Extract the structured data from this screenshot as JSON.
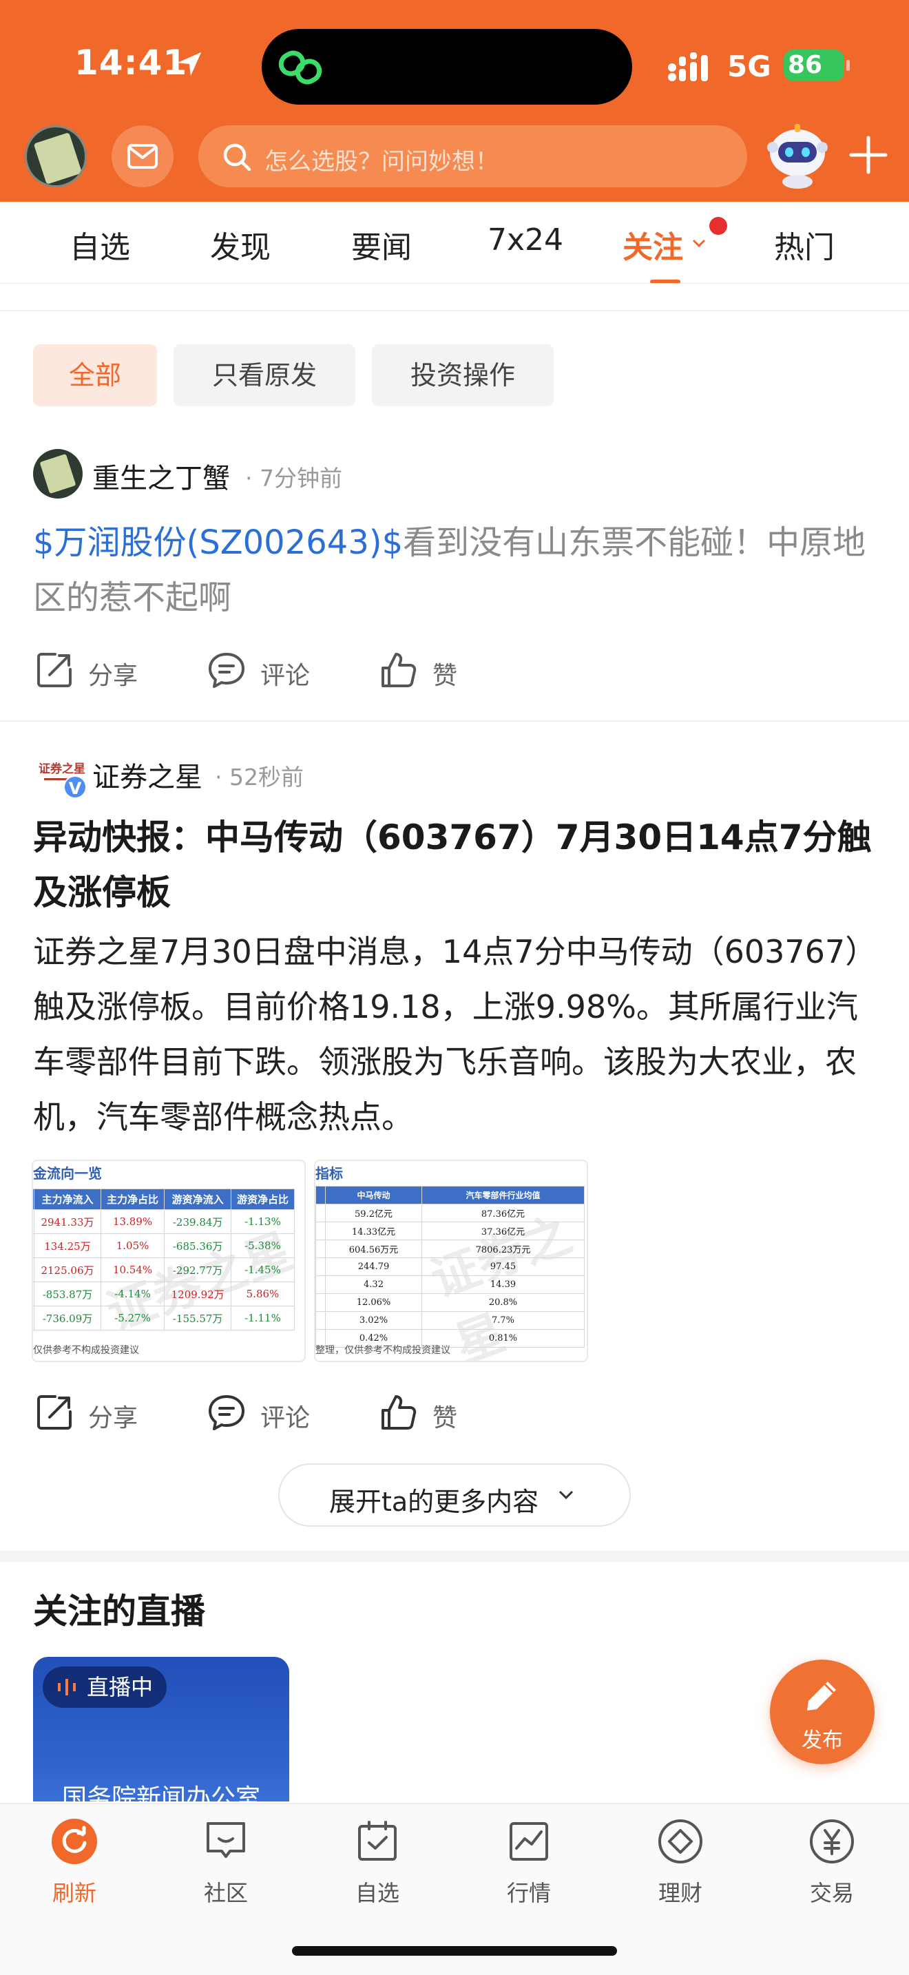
{
  "status_bar": {
    "time": "14:41",
    "network": "5G",
    "battery": "86"
  },
  "header": {
    "search_placeholder": "怎么选股？问问妙想！"
  },
  "tabs": [
    "自选",
    "发现",
    "要闻",
    "7x24",
    "关注",
    "热门"
  ],
  "filters": [
    "全部",
    "只看原发",
    "投资操作"
  ],
  "post1": {
    "author": "重生之丁蟹",
    "time": "· 7分钟前",
    "stock_tag": "$万润股份(SZ002643)$",
    "text": "看到没有山东票不能碰！中原地区的惹不起啊",
    "share": "分享",
    "comment": "评论",
    "like": "赞"
  },
  "post2": {
    "author": "证券之星",
    "logo_text": "证券之星",
    "verified": "V",
    "time": "· 52秒前",
    "title": "异动快报：中马传动（603767）7月30日14点7分触及涨停板",
    "body": "证券之星7月30日盘中消息，14点7分中马传动（603767）触及涨停板。目前价格19.18，上涨9.98%。其所属行业汽车零部件目前下跌。领涨股为飞乐音响。该股为大农业，农机，汽车零部件概念热点。",
    "share": "分享",
    "comment": "评论",
    "like": "赞",
    "thumb1": {
      "title": "金流向一览",
      "headers": [
        "主力净流入",
        "主力净占比",
        "游资净流入",
        "游资净占比"
      ],
      "rows": [
        [
          "2941.33万",
          "13.89%",
          "-239.84万",
          "-1.13%"
        ],
        [
          "134.25万",
          "1.05%",
          "-685.36万",
          "-5.38%"
        ],
        [
          "2125.06万",
          "10.54%",
          "-292.77万",
          "-1.45%"
        ],
        [
          "-853.87万",
          "-4.14%",
          "1209.92万",
          "5.86%"
        ],
        [
          "-736.09万",
          "-5.27%",
          "-155.57万",
          "-1.11%"
        ]
      ],
      "footer": "仅供参考不构成投资建议",
      "watermark": "证券之星"
    },
    "thumb2": {
      "title": "指标",
      "headers": [
        "中马传动",
        "汽车零部件行业均值"
      ],
      "rows": [
        [
          "59.2亿元",
          "87.36亿元"
        ],
        [
          "14.33亿元",
          "37.36亿元"
        ],
        [
          "604.56万元",
          "7806.23万元"
        ],
        [
          "244.79",
          "97.45"
        ],
        [
          "4.32",
          "14.39"
        ],
        [
          "12.06%",
          "20.8%"
        ],
        [
          "3.02%",
          "7.7%"
        ],
        [
          "0.42%",
          "0.81%"
        ]
      ],
      "footer": "整理，仅供参考不构成投资建议",
      "watermark": "证券之星"
    }
  },
  "expand_more": "展开ta的更多内容",
  "live": {
    "heading": "关注的直播",
    "badge": "直播中",
    "card_text": "国务院新闻办公室"
  },
  "fab_label": "发布",
  "bottom_nav": [
    "刷新",
    "社区",
    "自选",
    "行情",
    "理财",
    "交易"
  ],
  "colors": {
    "brand": "#f0692a",
    "link": "#2b6fd6",
    "up": "#d02020",
    "down": "#1d8a3a"
  }
}
